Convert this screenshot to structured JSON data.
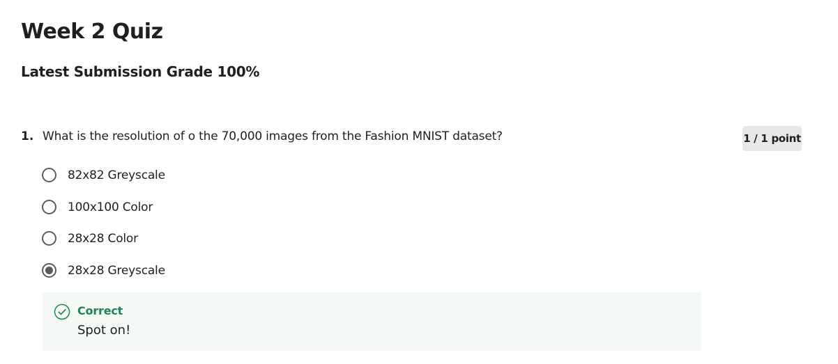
{
  "quiz": {
    "title": "Week 2 Quiz",
    "grade_text": "Latest Submission Grade 100%"
  },
  "question": {
    "number": "1.",
    "text": "What is the resolution of o the 70,000 images from the Fashion MNIST dataset?",
    "points": "1 / 1 point",
    "options": [
      {
        "label": "82x82 Greyscale",
        "selected": false
      },
      {
        "label": "100x100 Color",
        "selected": false
      },
      {
        "label": "28x28 Color",
        "selected": false
      },
      {
        "label": "28x28 Greyscale",
        "selected": true
      }
    ],
    "feedback": {
      "status": "Correct",
      "message": "Spot on!",
      "icon": "check-circle-icon"
    }
  },
  "colors": {
    "correct_green": "#1f8354",
    "feedback_bg": "#f4f9f6",
    "badge_bg": "#e8e8e8",
    "radio": "#5b5b5b"
  }
}
